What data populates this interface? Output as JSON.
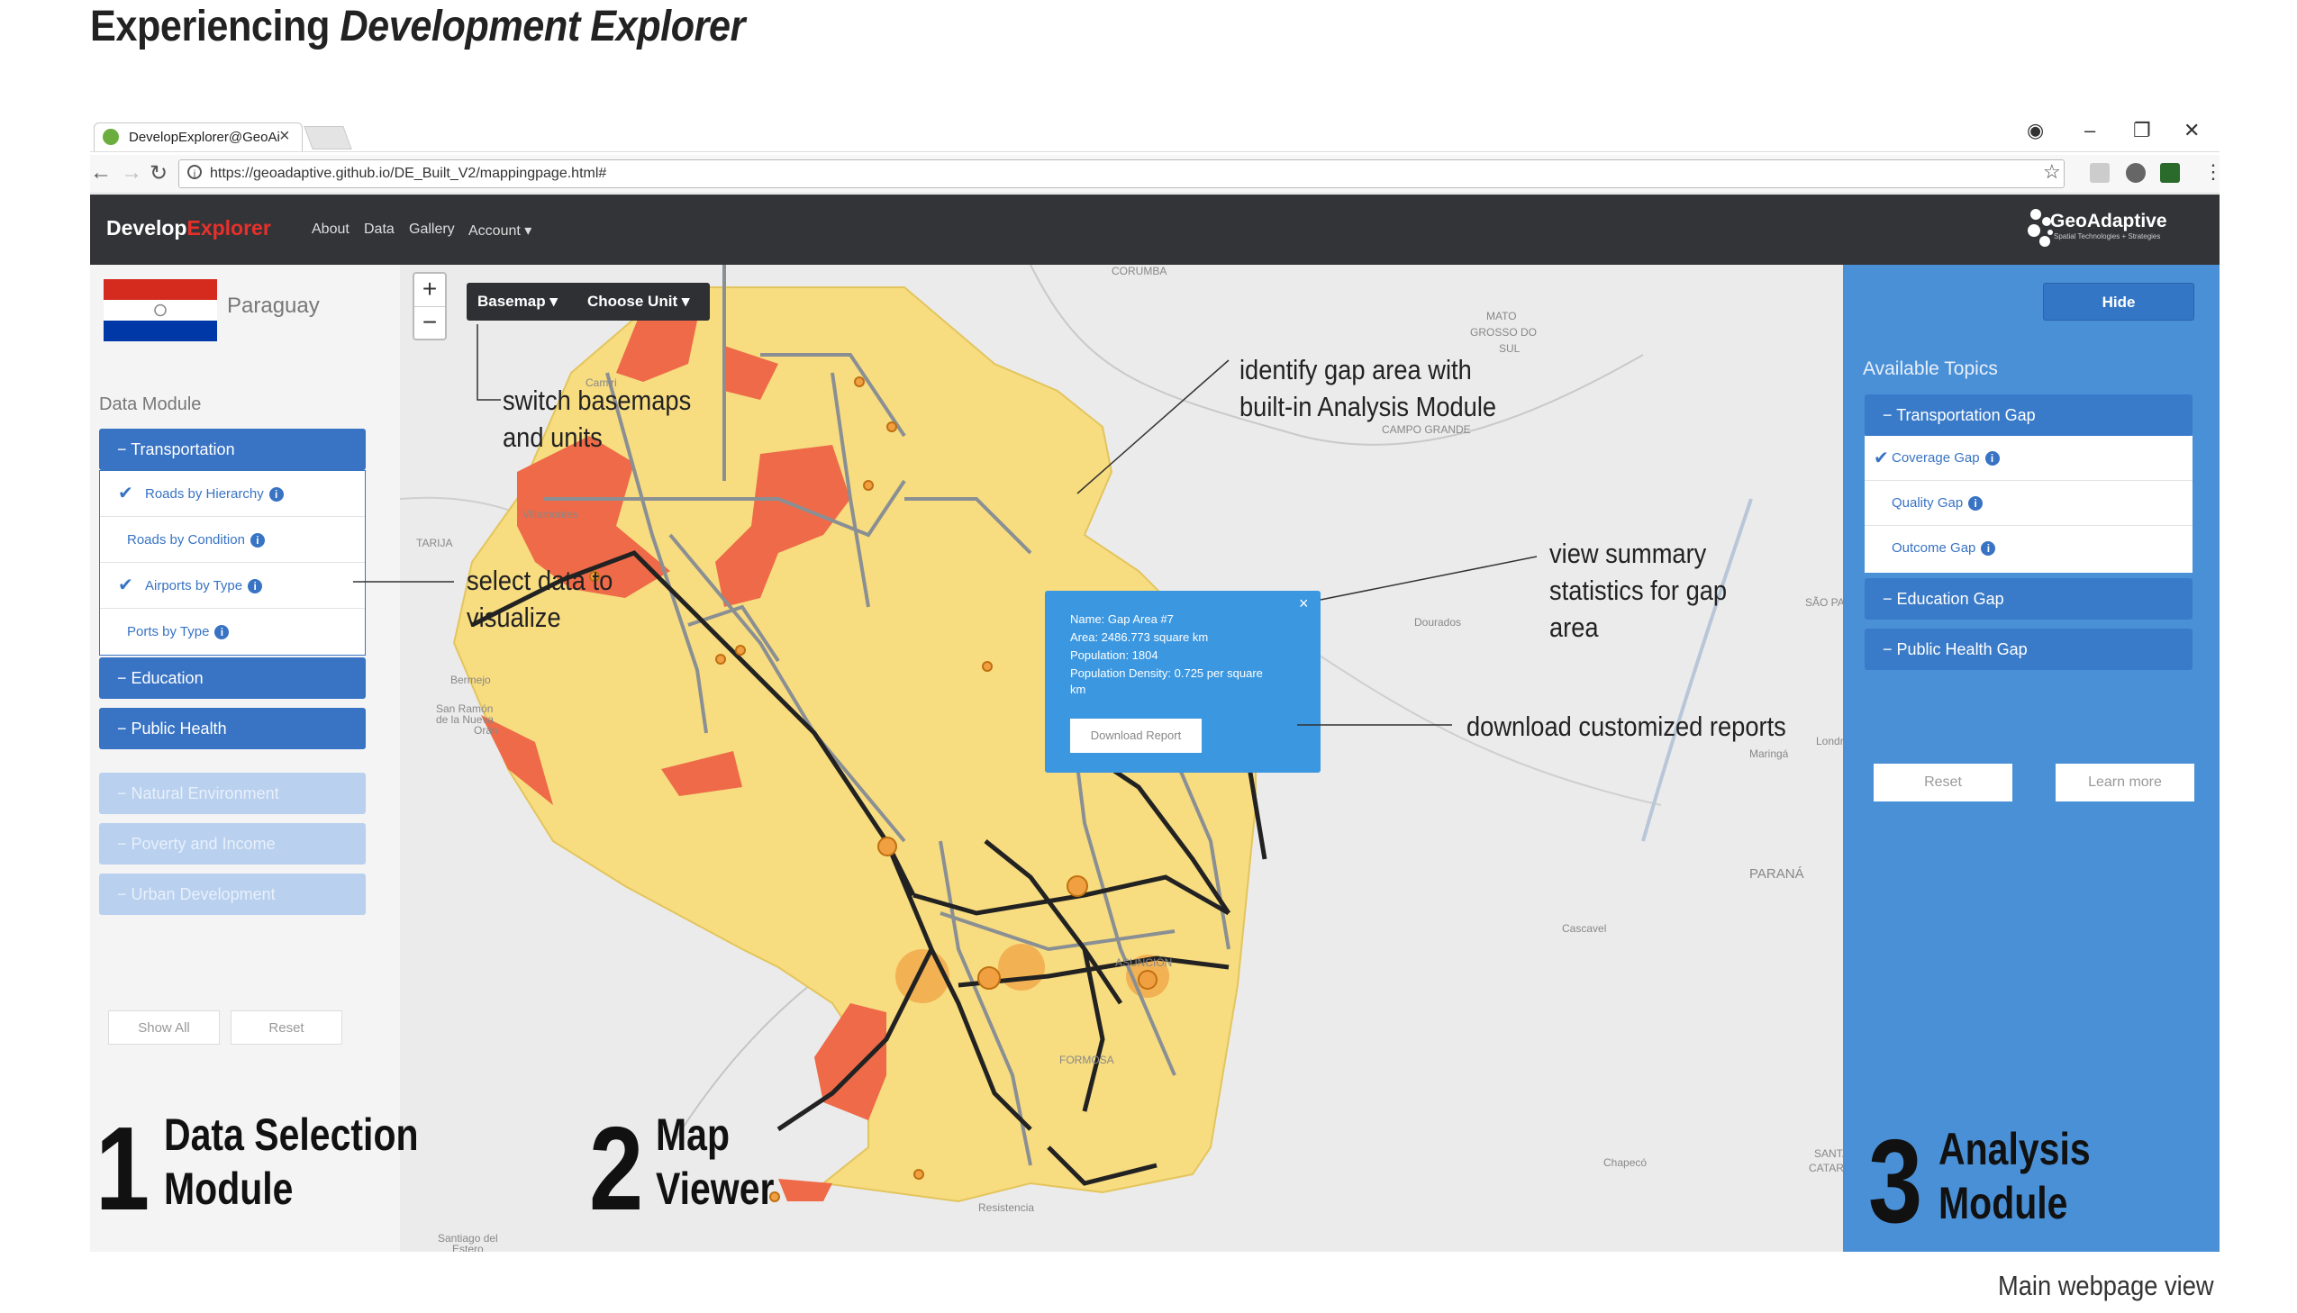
{
  "heading": {
    "plain": "Experiencing ",
    "italic": "Development Explorer"
  },
  "browser": {
    "tab_title": "DevelopExplorer@GeoAi",
    "url": "https://geoadaptive.github.io/DE_Built_V2/mappingpage.html#"
  },
  "app": {
    "brand_a": "Develop",
    "brand_b": "Explorer",
    "nav": [
      "About",
      "Data",
      "Gallery",
      "Account"
    ],
    "logo_text": "GeoAdaptive",
    "logo_sub": "Spatial Technologies + Strategies"
  },
  "left_panel": {
    "country": "Paraguay",
    "module_label": "Data Module",
    "categories_active": [
      "Transportation",
      "Education",
      "Public Health"
    ],
    "categories_disabled": [
      "Natural Environment",
      "Poverty and Income",
      "Urban Development"
    ],
    "sub_items": [
      {
        "label": "Roads by Hierarchy",
        "checked": true
      },
      {
        "label": "Roads by Condition",
        "checked": false
      },
      {
        "label": "Airports by Type",
        "checked": true
      },
      {
        "label": "Ports by Type",
        "checked": false
      }
    ],
    "show_all": "Show All",
    "reset": "Reset"
  },
  "map": {
    "zoom_in": "+",
    "zoom_out": "−",
    "basemap": "Basemap",
    "choose_unit": "Choose Unit",
    "popup": {
      "lines": [
        "Name: Gap Area #7",
        "Area: 2486.773 square km",
        "Population: 1804",
        "Population Density: 0.725 per square",
        "km"
      ],
      "button": "Download Report"
    },
    "labels": [
      "CORUMBA",
      "MATO",
      "GROSSO DO",
      "SUL",
      "CAMPO GRANDE",
      "Villamontes",
      "TARIJA",
      "Bermejo",
      "San Ramón",
      "de la Nueva",
      "Orán",
      "Dourados",
      "Maringá",
      "Londrina",
      "PARANÁ",
      "Cascavel",
      "ASUNCIÓN",
      "FORMOSA",
      "Chapecó",
      "Resistencia",
      "Santiago del",
      "Estero",
      "SÃO PAULO",
      "Camiri",
      "SANTA",
      "CATARINA"
    ],
    "colors": {
      "yellow": "#f7dc80",
      "orange": "#ee6a48",
      "road": "#222222",
      "grey_road": "#8a8f94"
    }
  },
  "right_panel": {
    "hide": "Hide",
    "available_topics": "Available Topics",
    "topics": [
      "Transportation Gap",
      "Education Gap",
      "Public Health Gap"
    ],
    "sub_topics": [
      {
        "label": "Coverage Gap",
        "checked": true
      },
      {
        "label": "Quality Gap",
        "checked": false
      },
      {
        "label": "Outcome Gap",
        "checked": false
      }
    ],
    "reset": "Reset",
    "learn_more": "Learn more"
  },
  "annotations": {
    "basemap": [
      "switch basemaps",
      "and units"
    ],
    "select": [
      "select data to",
      "visualize"
    ],
    "identify": [
      "identify gap area with",
      "built-in Analysis Module"
    ],
    "summary": [
      "view summary",
      "statistics  for gap",
      "area"
    ],
    "download": "download customized reports"
  },
  "sections": [
    {
      "num": "1",
      "label": [
        "Data Selection",
        "Module"
      ]
    },
    {
      "num": "2",
      "label": [
        "Map",
        "Viewer"
      ]
    },
    {
      "num": "3",
      "label": [
        "Analysis",
        "Module"
      ]
    }
  ],
  "caption": "Main webpage view"
}
